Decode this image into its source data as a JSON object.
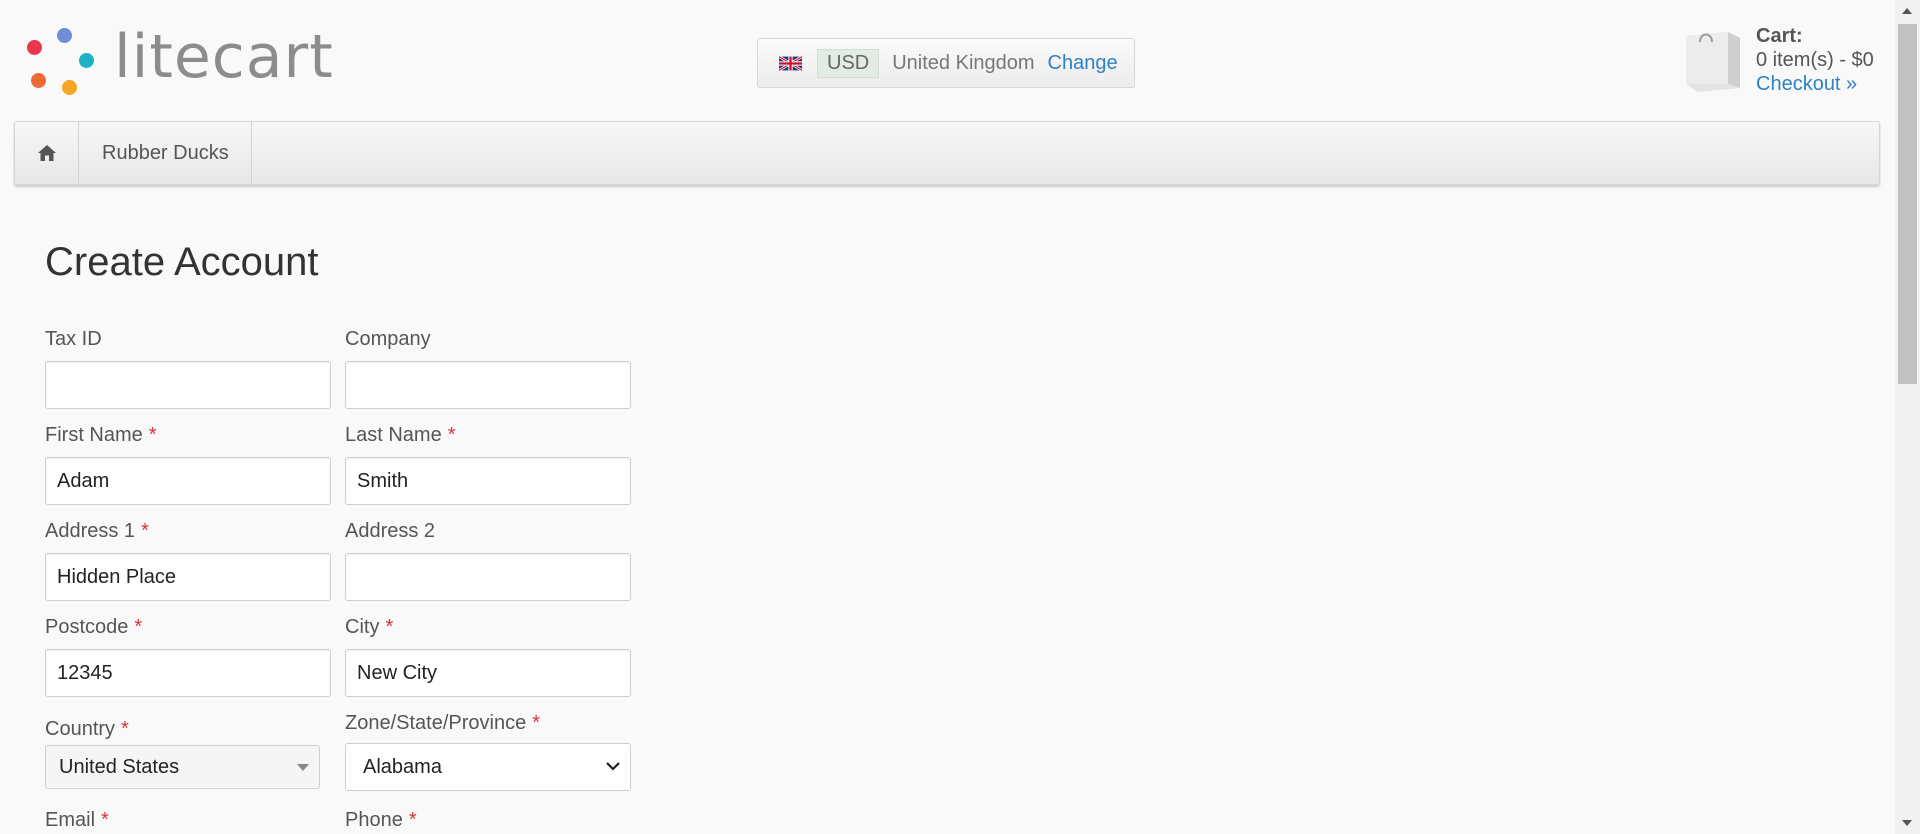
{
  "header": {
    "logo_text": "litecart",
    "logo_dot_colors": [
      "#e8384f",
      "#6e8fd6",
      "#1fb2c4",
      "#f06a35",
      "#f5a623"
    ],
    "region": {
      "flag_icon": "uk-flag-icon",
      "currency": "USD",
      "country": "United Kingdom",
      "change_label": "Change"
    },
    "cart": {
      "icon": "shopping-bag-icon",
      "label": "Cart:",
      "summary": "0 item(s) - $0",
      "checkout_label": "Checkout »"
    }
  },
  "navbar": {
    "home_icon": "home-icon",
    "items": [
      {
        "label": "Rubber Ducks"
      }
    ]
  },
  "main": {
    "title": "Create Account",
    "form": {
      "tax_id": {
        "label": "Tax ID",
        "value": ""
      },
      "company": {
        "label": "Company",
        "value": ""
      },
      "first_name": {
        "label": "First Name",
        "value": "Adam"
      },
      "last_name": {
        "label": "Last Name",
        "value": "Smith"
      },
      "address1": {
        "label": "Address 1",
        "value": "Hidden Place"
      },
      "address2": {
        "label": "Address 2",
        "value": ""
      },
      "postcode": {
        "label": "Postcode",
        "value": "12345"
      },
      "city": {
        "label": "City",
        "value": "New City"
      },
      "country": {
        "label": "Country",
        "value": "United States"
      },
      "zone": {
        "label": "Zone/State/Province",
        "value": "Alabama"
      },
      "email": {
        "label": "Email"
      },
      "phone": {
        "label": "Phone"
      },
      "required_marker": "*"
    }
  },
  "colors": {
    "link": "#2e82c7",
    "required": "#d9323c"
  }
}
